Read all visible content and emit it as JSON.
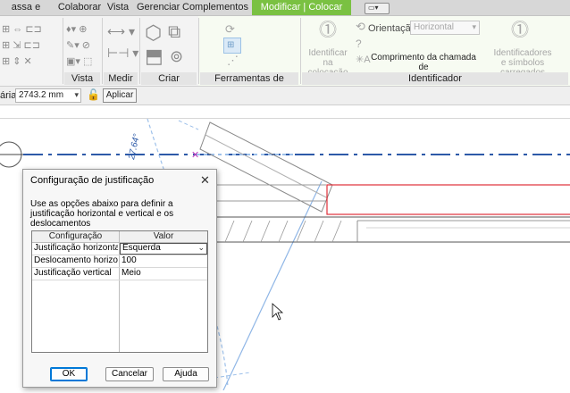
{
  "ribbon": {
    "tabs": [
      {
        "label": "assa e terreno",
        "active": false
      },
      {
        "label": "Colaborar",
        "active": false
      },
      {
        "label": "Vista",
        "active": false
      },
      {
        "label": "Gerenciar",
        "active": false
      },
      {
        "label": "Complementos",
        "active": false
      },
      {
        "label": "Modificar | Colocar Duto",
        "active": true
      }
    ],
    "panels": {
      "vista": "Vista",
      "medir": "Medir",
      "criar": "Criar",
      "ferramentas": "Ferramentas de colocação",
      "identificador": "Identificador"
    },
    "identificador": {
      "tag_on_placement": "Identificar\nna colocação",
      "orientation_label": "Orientação",
      "orientation_value": "Horizontal",
      "leader_length": "Comprimento da chamada de\ndetalhe",
      "loaded_tags": "Identificadores\ne símbolos carregados"
    }
  },
  "options_bar": {
    "label_fragment": "ária:",
    "value": "2743.2 mm",
    "apply_button": "Aplicar"
  },
  "canvas": {
    "angle_text": "27.64°"
  },
  "dialog": {
    "title": "Configuração de justificação",
    "description": "Use as opções abaixo para definir a justificação horizontal e vertical e os deslocamentos",
    "columns": [
      "Configuração",
      "Valor"
    ],
    "rows": [
      {
        "setting": "Justificação horizontal",
        "value": "Esquerda",
        "dropdown": true
      },
      {
        "setting": "Deslocamento horizont",
        "value": "100",
        "dropdown": false
      },
      {
        "setting": "Justificação vertical",
        "value": "Meio",
        "dropdown": false
      }
    ],
    "buttons": {
      "ok": "OK",
      "cancel": "Cancelar",
      "help": "Ajuda"
    }
  },
  "colors": {
    "accent": "#7ac142",
    "duct_highlight": "#e0303a",
    "guide_blue": "#2d5aa8"
  }
}
